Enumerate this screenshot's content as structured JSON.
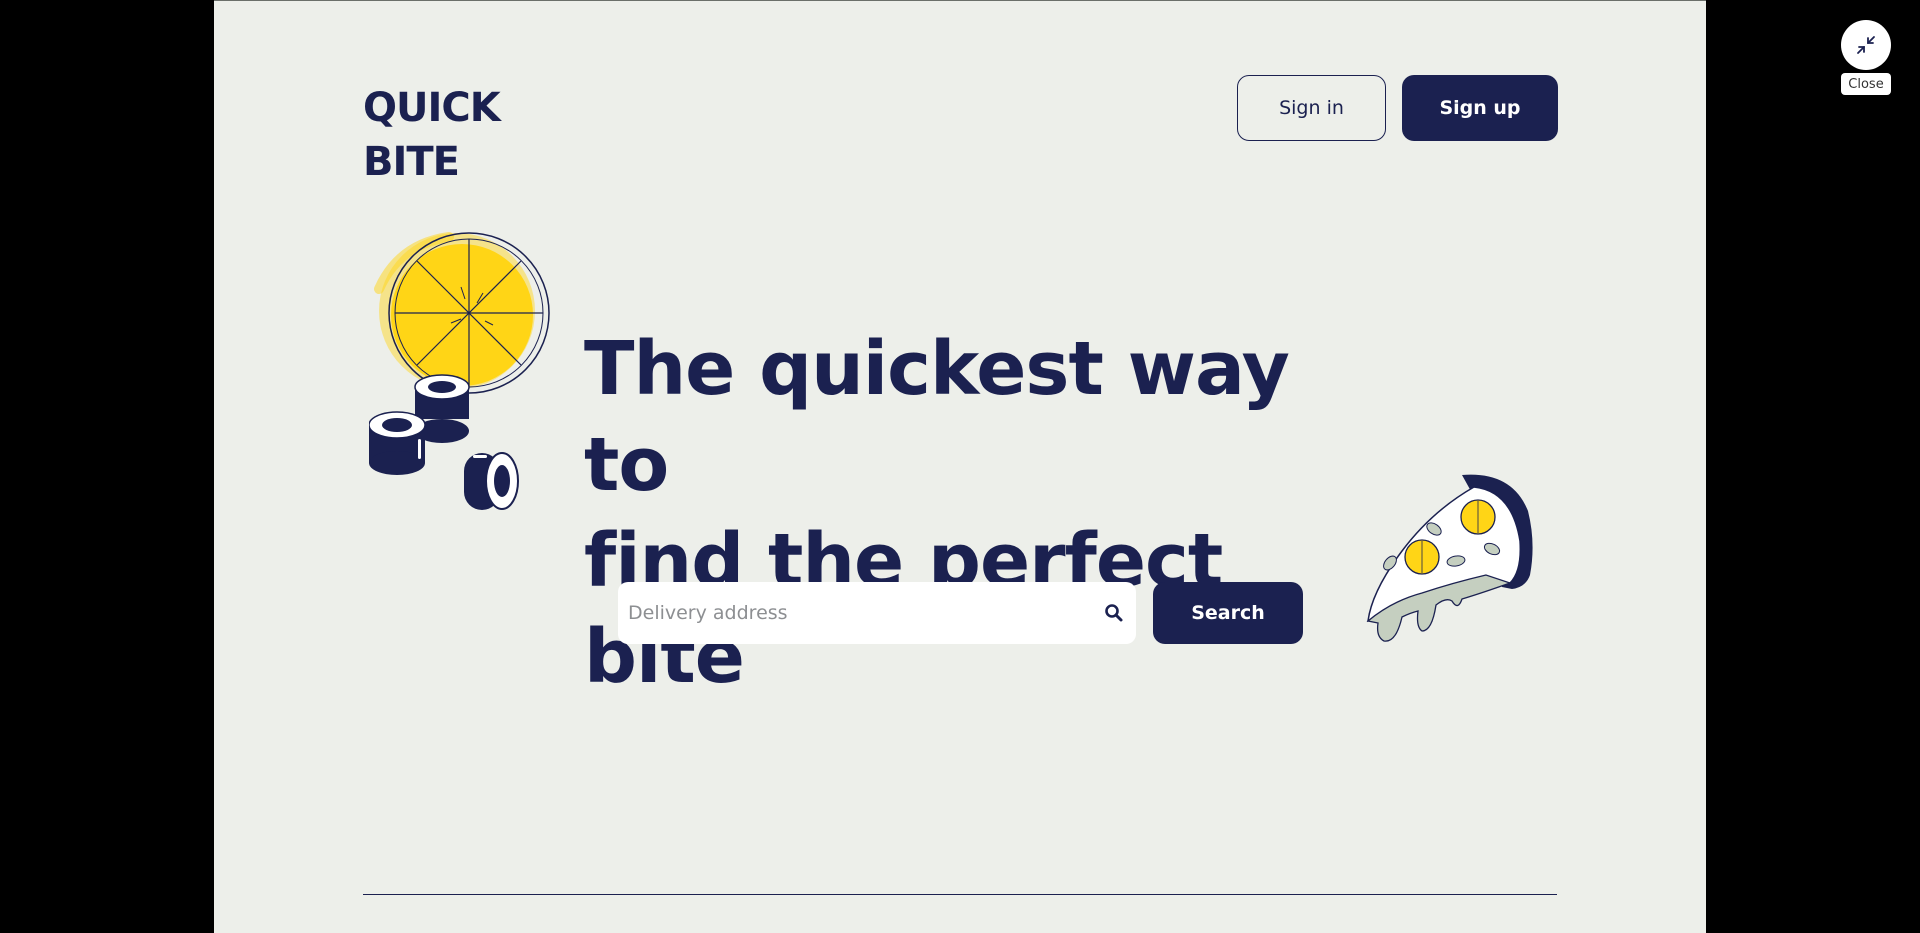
{
  "brand": {
    "logo_line1": "QUICK",
    "logo_line2": "BITE"
  },
  "header": {
    "signin_label": "Sign in",
    "signup_label": "Sign up"
  },
  "hero": {
    "headline_line1": "The quickest way to",
    "headline_line2": "find the perfect bite"
  },
  "search": {
    "placeholder": "Delivery address",
    "value": "",
    "button_label": "Search",
    "icon": "search-icon"
  },
  "overlay": {
    "close_icon": "minimize-icon",
    "close_tooltip": "Close"
  },
  "colors": {
    "navy": "#1B2150",
    "background": "#EDEFEA",
    "yellow": "#FFD516",
    "sage": "#C5CFC0",
    "frame": "#000000"
  }
}
